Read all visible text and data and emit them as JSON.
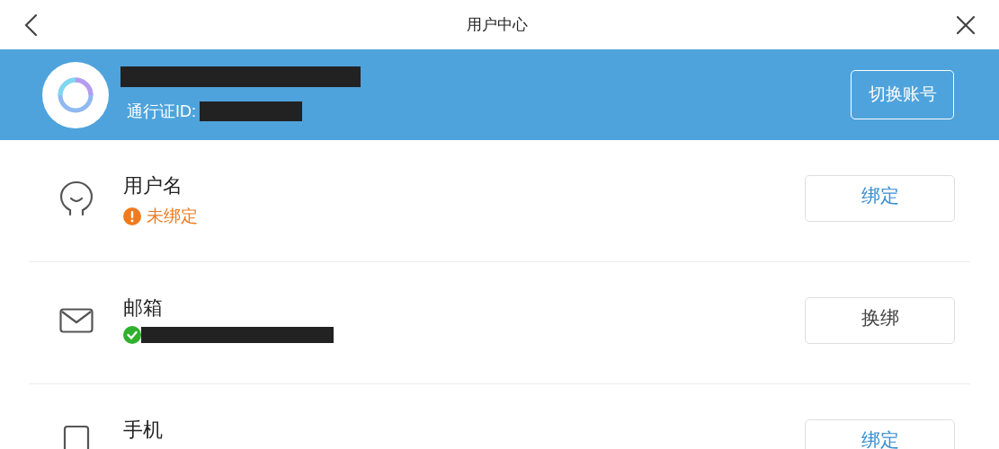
{
  "window": {
    "title": "用户中心"
  },
  "account": {
    "id_label": "通行证ID:",
    "switch_button": "切换账号"
  },
  "rows": [
    {
      "kind": "user",
      "label": "用户名",
      "status": {
        "kind": "unbound",
        "text": "未绑定"
      },
      "button": {
        "kind": "bind",
        "label": "绑定"
      }
    },
    {
      "kind": "mail",
      "label": "邮箱",
      "status": {
        "kind": "bound"
      },
      "button": {
        "kind": "rebind",
        "label": "换绑"
      }
    },
    {
      "kind": "phone",
      "label": "手机",
      "button": {
        "kind": "bind",
        "label": "绑定"
      }
    }
  ]
}
